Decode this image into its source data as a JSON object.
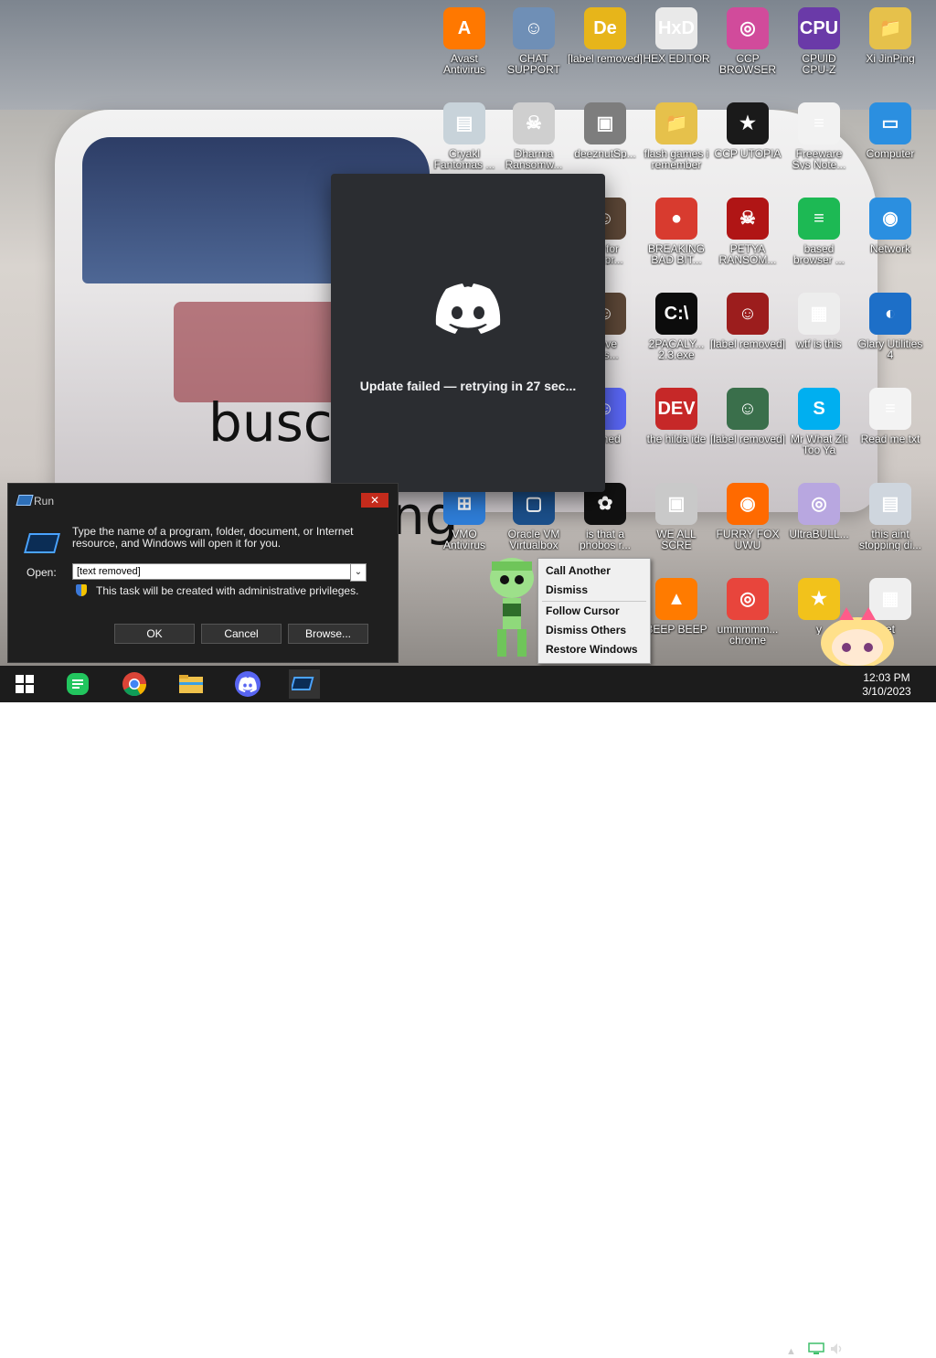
{
  "desktop": {
    "icons": [
      {
        "label": "Avast\nAntivirus",
        "color": "#ff7800",
        "glyph": "A"
      },
      {
        "label": "CHAT\nSUPPORT",
        "color": "#6f8fb6",
        "glyph": "☺"
      },
      {
        "label": "[label removed]",
        "color": "#e7b51a",
        "glyph": "De"
      },
      {
        "label": "HEX EDITOR",
        "color": "#e9e9e9",
        "glyph": "HxD"
      },
      {
        "label": "CCP\nBROWSER",
        "color": "#d14b9b",
        "glyph": "◎"
      },
      {
        "label": "CPUID\nCPU-Z",
        "color": "#6a3aa8",
        "glyph": "CPU"
      },
      {
        "label": "Xi JinPing",
        "color": "#e6c14b",
        "glyph": "📁"
      },
      {
        "label": "Cryakl\nFantomas ...",
        "color": "#c8d3da",
        "glyph": "▤"
      },
      {
        "label": "Dharma\nRansomw...",
        "color": "#cfcfcf",
        "glyph": "☠"
      },
      {
        "label": "deeznutSp...",
        "color": "#7d7d7d",
        "glyph": "▣"
      },
      {
        "label": "flash games i\nremember",
        "color": "#e6c14b",
        "glyph": "📁"
      },
      {
        "label": "CCP UTOPIA",
        "color": "#1a1a1a",
        "glyph": "★"
      },
      {
        "label": "Freeware\nSys Note...",
        "color": "#f2f2f2",
        "glyph": "≡"
      },
      {
        "label": "Computer",
        "color": "#2b8fe0",
        "glyph": "▭"
      },
      {
        "label": "BREAKING\nBAD BIT...",
        "color": "#d83b2f",
        "glyph": "●"
      },
      {
        "label": "PETYA\nRANSOM...",
        "color": "#b01515",
        "glyph": "☠"
      },
      {
        "label": "based\nbrowser ...",
        "color": "#1db954",
        "glyph": "≡"
      },
      {
        "label": "Network",
        "color": "#2b8fe0",
        "glyph": "◉"
      },
      {
        "label": "2PACALY...\n2.3.exe",
        "color": "#0c0c0c",
        "glyph": "C:\\"
      },
      {
        "label": "[label removed]",
        "color": "#9c1d1d",
        "glyph": "☺"
      },
      {
        "label": "wtf is this",
        "color": "#ededed",
        "glyph": "▦"
      },
      {
        "label": "Glary Utilities\n4",
        "color": "#1d6fc8",
        "glyph": "◐"
      },
      {
        "label": "the hilda ide",
        "color": "#c62828",
        "glyph": "DEV"
      },
      {
        "label": "[label removed]",
        "color": "#3a6f4b",
        "glyph": "☺"
      },
      {
        "label": "Mr What Zit\nToo Ya",
        "color": "#00aff0",
        "glyph": "S"
      },
      {
        "label": "Read me.txt",
        "color": "#f3f3f3",
        "glyph": "≡"
      },
      {
        "label": "VMO\nAntivirus",
        "color": "#2e7dd7",
        "glyph": "⊞"
      },
      {
        "label": "Oracle VM\nVirtualbox",
        "color": "#1b4f8a",
        "glyph": "▢"
      },
      {
        "label": "is that a\nphobos r...",
        "color": "#111111",
        "glyph": "✿"
      },
      {
        "label": "WE ALL\nSCRE",
        "color": "#c9c9c9",
        "glyph": "▣"
      },
      {
        "label": "FURRY FOX\nUWU",
        "color": "#ff6a00",
        "glyph": "◉"
      },
      {
        "label": "UltraBULL...",
        "color": "#b8a7e0",
        "glyph": "◎"
      },
      {
        "label": "this aint\nstopping di...",
        "color": "#cfd6de",
        "glyph": "▤"
      },
      {
        "label": "BEEP BEEP",
        "color": "#ff7b00",
        "glyph": "▲"
      },
      {
        "label": "ummmmm...\nchrome",
        "color": "#e8453c",
        "glyph": "◎"
      },
      {
        "label": "bit for\nset pr...",
        "color": "#5b4636",
        "glyph": "☺"
      },
      {
        "label": "bove\nto s...",
        "color": "#5b4636",
        "glyph": "☺"
      },
      {
        "label": "anned",
        "color": "#5865f2",
        "glyph": "☺"
      },
      {
        "label": "y",
        "color": "#f2c21b",
        "glyph": "★"
      },
      {
        "label": "et",
        "color": "#efefef",
        "glyph": "▦"
      }
    ]
  },
  "discord": {
    "status": "Update failed — retrying in 27 sec..."
  },
  "run_dialog": {
    "title": "Run",
    "close": "✕",
    "description": "Type the name of a program, folder, document, or Internet resource, and Windows will open it for you.",
    "open_label": "Open:",
    "input_value": "[text removed]",
    "dropdown": "⌄",
    "admin_note": "This task will be created with administrative privileges.",
    "ok": "OK",
    "cancel": "Cancel",
    "browse": "Browse..."
  },
  "context_menu": {
    "items": [
      "Call Another",
      "Dismiss",
      "Follow Cursor",
      "Dismiss Others",
      "Restore Windows"
    ]
  },
  "taskbar": {
    "time": "12:03 PM",
    "date": "3/10/2023",
    "tray_arrow": "▲"
  },
  "wallpaper_text": {
    "line1": "busc",
    "line2": "ng"
  }
}
